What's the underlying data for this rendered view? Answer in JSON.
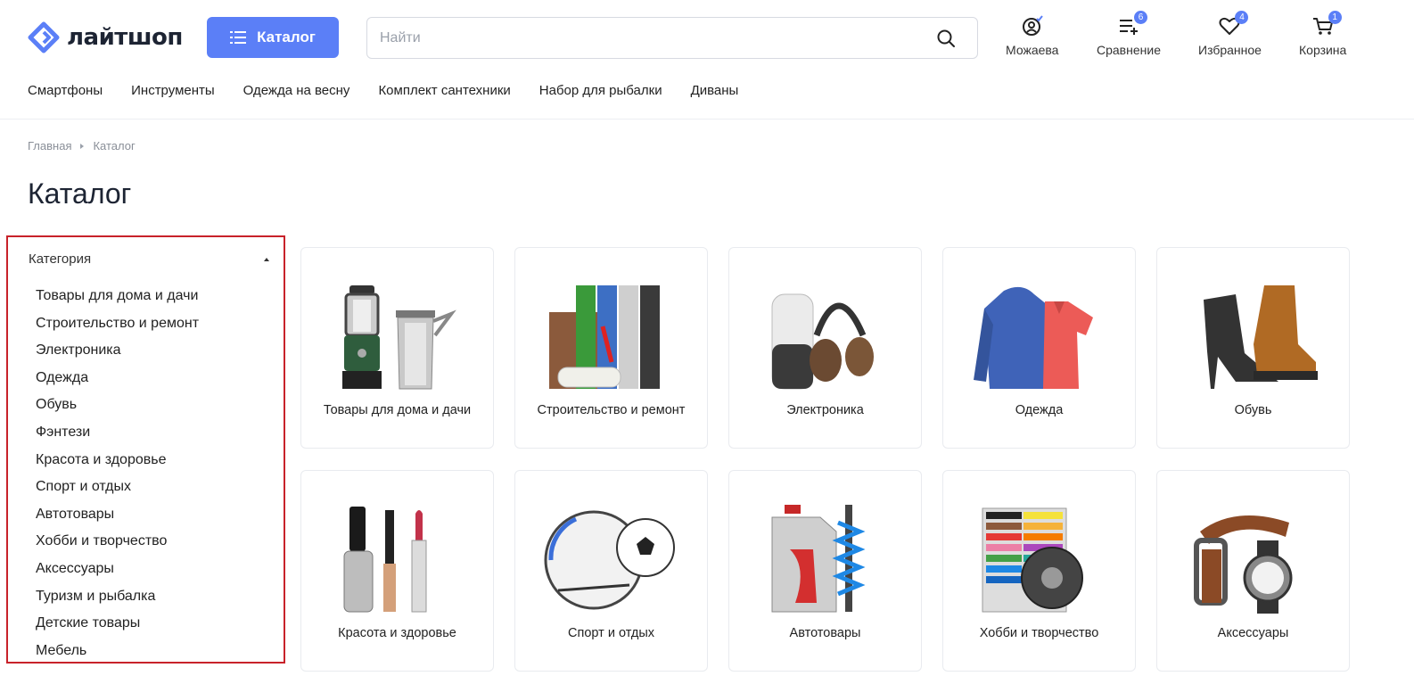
{
  "logo": {
    "text": "лайтшоп"
  },
  "catalog_button": {
    "label": "Каталог"
  },
  "search": {
    "placeholder": "Найти",
    "value": ""
  },
  "header_actions": [
    {
      "label": "Можаева",
      "icon": "user-icon",
      "badge": ""
    },
    {
      "label": "Сравнение",
      "icon": "compare-icon",
      "badge": "6"
    },
    {
      "label": "Избранное",
      "icon": "heart-icon",
      "badge": "4"
    },
    {
      "label": "Корзина",
      "icon": "cart-icon",
      "badge": "1"
    }
  ],
  "top_nav": [
    "Смартфоны",
    "Инструменты",
    "Одежда на весну",
    "Комплект сантехники",
    "Набор для рыбалки",
    "Диваны"
  ],
  "breadcrumb": [
    "Главная",
    "Каталог"
  ],
  "page_title": "Каталог",
  "sidebar": {
    "title": "Категория",
    "items": [
      "Товары для дома и дачи",
      "Строительство и ремонт",
      "Электроника",
      "Одежда",
      "Обувь",
      "Фэнтези",
      "Красота и здоровье",
      "Спорт и отдых",
      "Автотовары",
      "Хобби и творчество",
      "Аксессуары",
      "Туризм и рыбалка",
      "Детские товары",
      "Мебель"
    ]
  },
  "categories": [
    {
      "label": "Товары для дома и дачи",
      "image": "lantern-kettle-image"
    },
    {
      "label": "Строительство и ремонт",
      "image": "wallpaper-roller-image"
    },
    {
      "label": "Электроника",
      "image": "speaker-headphones-image"
    },
    {
      "label": "Одежда",
      "image": "hoodie-shirt-image"
    },
    {
      "label": "Обувь",
      "image": "shoes-image"
    },
    {
      "label": "Красота и здоровье",
      "image": "cosmetics-image"
    },
    {
      "label": "Спорт и отдых",
      "image": "unicycle-ball-image"
    },
    {
      "label": "Автотовары",
      "image": "oil-shock-absorber-image"
    },
    {
      "label": "Хобби и творчество",
      "image": "plasticine-yarn-image"
    },
    {
      "label": "Аксессуары",
      "image": "belt-watch-image"
    }
  ],
  "colors": {
    "accent": "#5b7ff7",
    "highlight_border": "#c8222a"
  }
}
